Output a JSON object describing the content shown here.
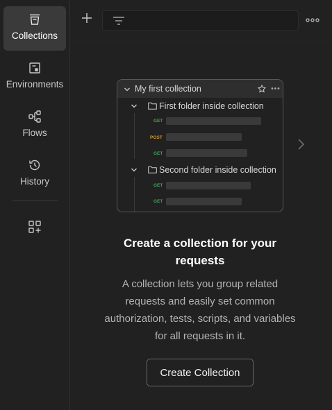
{
  "sidebar": {
    "items": [
      {
        "label": "Collections",
        "icon": "collections-icon",
        "active": true
      },
      {
        "label": "Environments",
        "icon": "environments-icon",
        "active": false
      },
      {
        "label": "Flows",
        "icon": "flows-icon",
        "active": false
      },
      {
        "label": "History",
        "icon": "history-icon",
        "active": false
      }
    ],
    "configure_icon": "add-workbench-icon"
  },
  "toolbar": {
    "new_icon": "plus-icon",
    "filter_icon": "filter-icon",
    "more_icon": "more-icon"
  },
  "illustration": {
    "collection_name": "My first collection",
    "folders": [
      {
        "name": "First folder inside collection",
        "methods": [
          "GET",
          "POST",
          "GET"
        ]
      },
      {
        "name": "Second folder inside collection",
        "methods": [
          "GET",
          "GET"
        ]
      }
    ]
  },
  "empty_state": {
    "title": "Create a collection for your requests",
    "description": "A collection lets you group related requests and easily set common authorization, tests, scripts, and variables for all requests in it.",
    "button_label": "Create Collection"
  },
  "colors": {
    "background": "#212121",
    "active_item": "#3a3a3a",
    "get_method": "#3ba55c",
    "post_method": "#d1922f"
  }
}
